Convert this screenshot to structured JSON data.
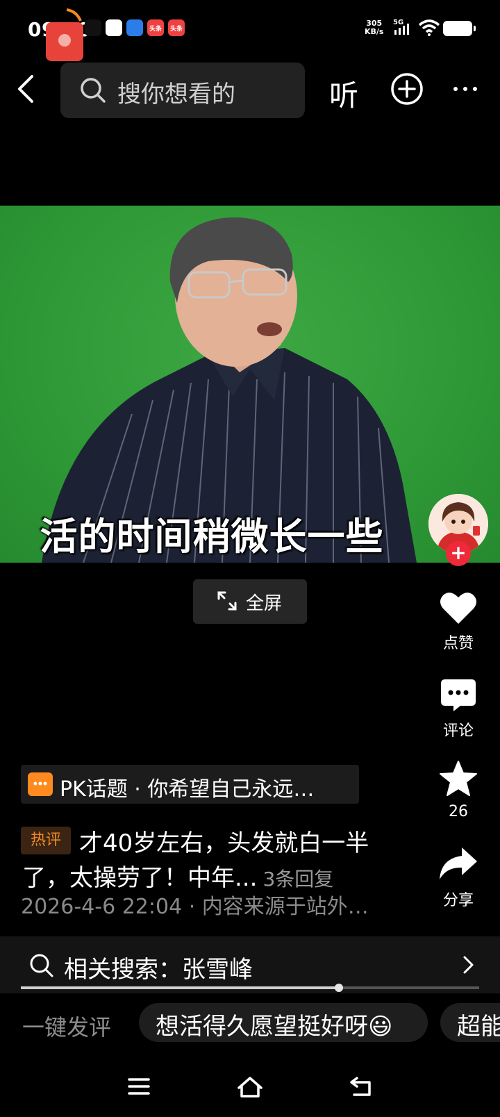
{
  "status_bar": {
    "time": "09:40",
    "net_speed_value": "305",
    "net_speed_unit": "KB/s",
    "signal_label": "5G",
    "notification_icons": [
      {
        "icon": "tiktok-icon",
        "bg": "#111111",
        "fg": "#ffffff",
        "text": ""
      },
      {
        "icon": "green-app-icon",
        "bg": "#ffffff",
        "fg": "#26b14a",
        "text": ""
      },
      {
        "icon": "blue-app-icon",
        "bg": "#2b7de9",
        "fg": "#ffffff",
        "text": ""
      },
      {
        "icon": "toutiao-lite-icon",
        "bg": "#f04142",
        "fg": "#ffffff",
        "text": "头条"
      },
      {
        "icon": "toutiao-icon",
        "bg": "#f04142",
        "fg": "#ffffff",
        "text": "头条"
      }
    ]
  },
  "nav": {
    "search_placeholder": "搜你想看的",
    "listen_label": "听"
  },
  "video": {
    "subtitle": "活的时间稍微长一些",
    "fullscreen_label": "全屏"
  },
  "actions": {
    "like_label": "点赞",
    "comment_label": "评论",
    "favorite_count": "26",
    "share_label": "分享"
  },
  "topic": {
    "text": "PK话题 · 你希望自己永远…"
  },
  "hot_comment": {
    "tag": "热评",
    "line1": "才40岁左右，头发就白一半",
    "line2": "了，太操劳了！中年...",
    "replies": "3条回复",
    "meta": "2026-4-6 22:04 · 内容来源于站外…"
  },
  "related_search": {
    "text": "相关搜索：张雪峰"
  },
  "player": {
    "progress_fraction": 0.694
  },
  "quick_comment": {
    "label": "一键发评",
    "chips": [
      "想活得久愿望挺好呀😃",
      "超能"
    ]
  },
  "colors": {
    "accent_red": "#ee2a3a",
    "hot_tag": "#f08a28",
    "topic_icon": "#ff8a1f",
    "video_green": "#2f9a37"
  }
}
